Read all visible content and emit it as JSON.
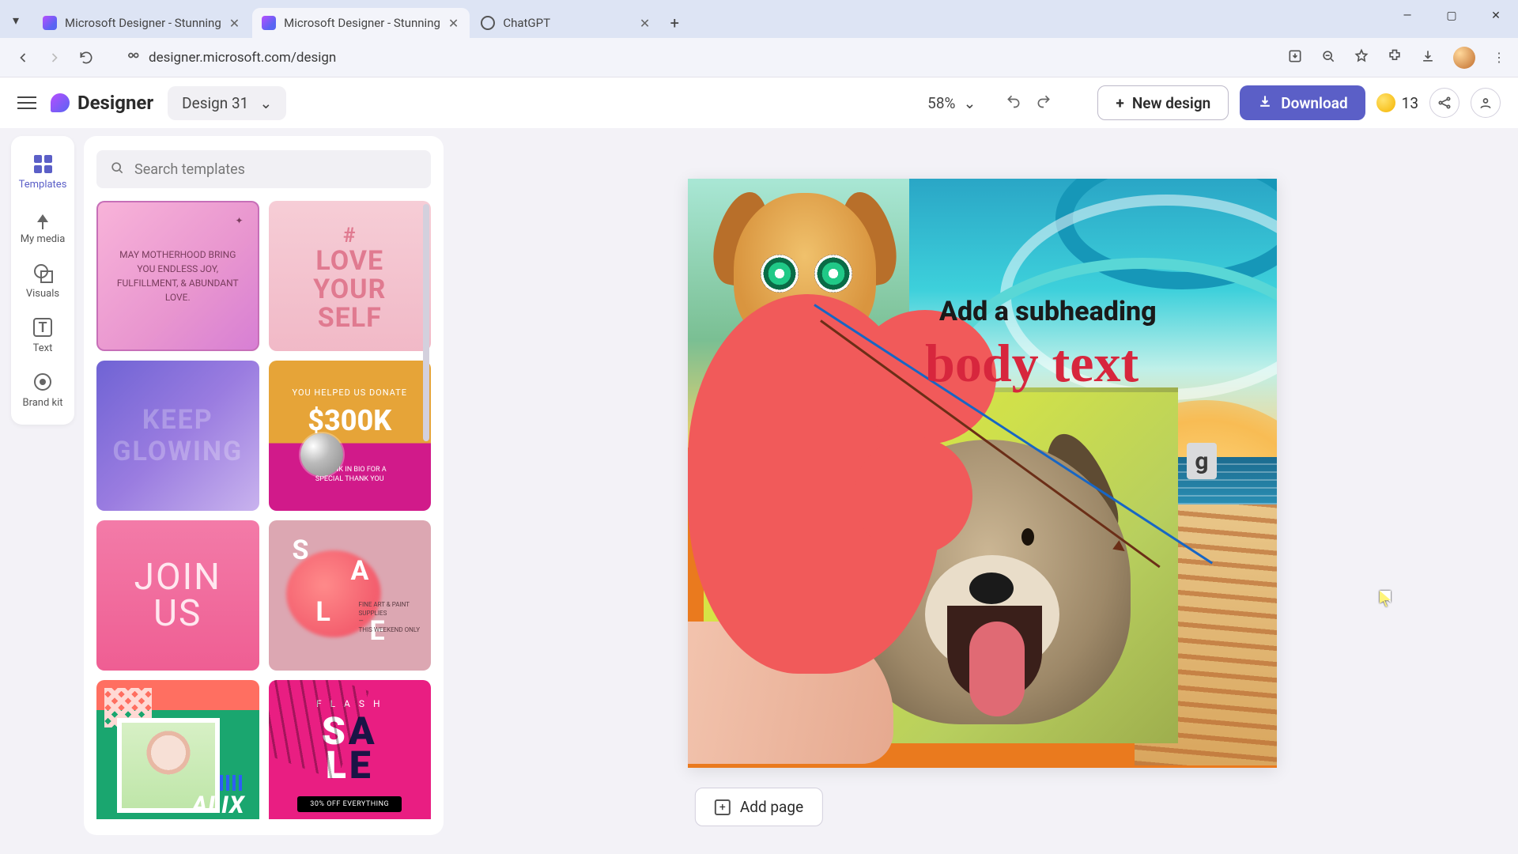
{
  "browser": {
    "tabs": [
      {
        "title": "Microsoft Designer - Stunning",
        "favicon": "designer",
        "active": false
      },
      {
        "title": "Microsoft Designer - Stunning",
        "favicon": "designer",
        "active": true
      },
      {
        "title": "ChatGPT",
        "favicon": "chatgpt",
        "active": false
      }
    ],
    "url": "designer.microsoft.com/design"
  },
  "app": {
    "brand": "Designer",
    "design_name": "Design 31",
    "zoom": "58%",
    "new_design": "New design",
    "download": "Download",
    "credits": "13"
  },
  "rail": {
    "templates": "Templates",
    "my_media": "My media",
    "visuals": "Visuals",
    "text": "Text",
    "brand_kit": "Brand kit"
  },
  "panel": {
    "search_placeholder": "Search templates",
    "thumbs": {
      "t1": "MAY MOTHERHOOD BRING YOU ENDLESS JOY, FULFILLMENT, & ABUNDANT LOVE.",
      "t2_hash": "#",
      "t2_line": "LOVE\nYOUR\nSELF",
      "t3": "KEEP GLOWING",
      "t4_l1": "YOU HELPED US DONATE",
      "t4_l2": "$300K",
      "t4_l3": "TAP LINK IN BIO FOR A\nSPECIAL THANK YOU",
      "t5": "JOIN\nUS",
      "t6_fine": "FINE ART & PAINT\nSUPPLIES\n—\nTHIS WEEKEND ONLY",
      "t7_name": "ALIX",
      "t8_flash": "F L A S H",
      "t8_pill": "30% OFF EVERYTHING"
    }
  },
  "canvas": {
    "subheading": "Add a subheading",
    "body": "body text",
    "tag_letter": "g"
  },
  "footer": {
    "add_page": "Add page"
  }
}
